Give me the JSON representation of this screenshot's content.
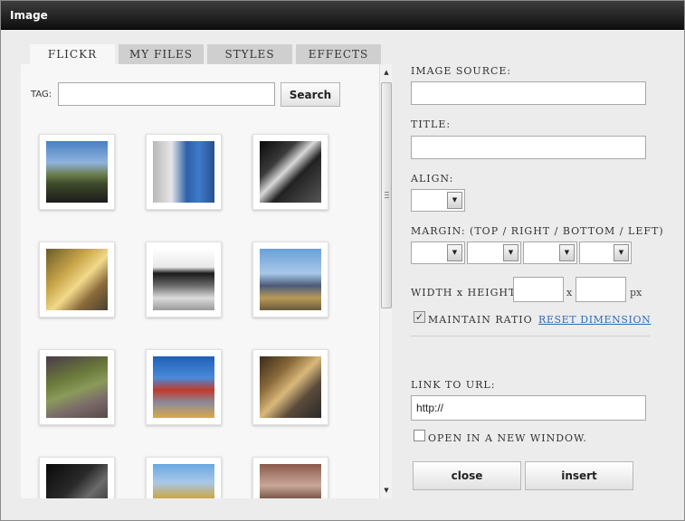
{
  "window": {
    "title": "Image"
  },
  "tabs": [
    {
      "label": "FLICKR"
    },
    {
      "label": "MY FILES"
    },
    {
      "label": "STYLES"
    },
    {
      "label": "EFFECTS"
    }
  ],
  "flickr": {
    "tag_label": "TAG:",
    "tag_value": "",
    "search_label": "Search"
  },
  "form": {
    "image_source_label": "IMAGE SOURCE:",
    "image_source_value": "",
    "title_label": "TITLE:",
    "title_value": "",
    "align_label": "ALIGN:",
    "margin_label": "MARGIN: (TOP / RIGHT / BOTTOM / LEFT)",
    "size_label": "WIDTH x HEIGHT:",
    "times": "x",
    "unit": "px",
    "maintain_ratio_label": "MAINTAIN RATIO",
    "maintain_ratio_checked": true,
    "reset_label": "RESET DIMENSION",
    "link_label": "LINK TO URL:",
    "link_value": "http://",
    "new_window_label": "OPEN IN A NEW WINDOW.",
    "new_window_checked": false,
    "close_label": "close",
    "insert_label": "insert"
  }
}
